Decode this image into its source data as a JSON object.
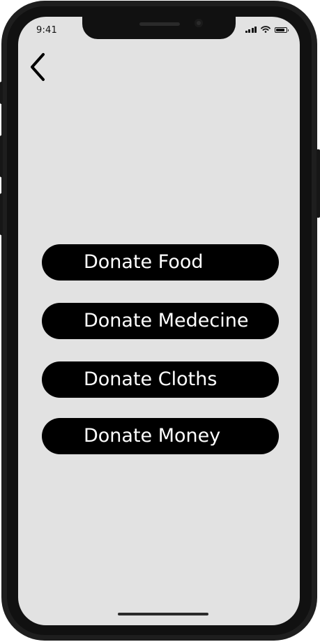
{
  "status_bar": {
    "time": "9:41",
    "battery_level": 0.85
  },
  "navigation": {
    "back_icon": "chevron-left-icon"
  },
  "donate_menu": {
    "items": [
      {
        "label": "Donate Food"
      },
      {
        "label": "Donate Medecine"
      },
      {
        "label": "Donate Cloths"
      },
      {
        "label": "Donate Money"
      }
    ]
  },
  "colors": {
    "screen_background": "#e2e2e2",
    "button_background": "#000000",
    "button_text": "#ffffff",
    "device_frame": "#1e1e1e"
  }
}
